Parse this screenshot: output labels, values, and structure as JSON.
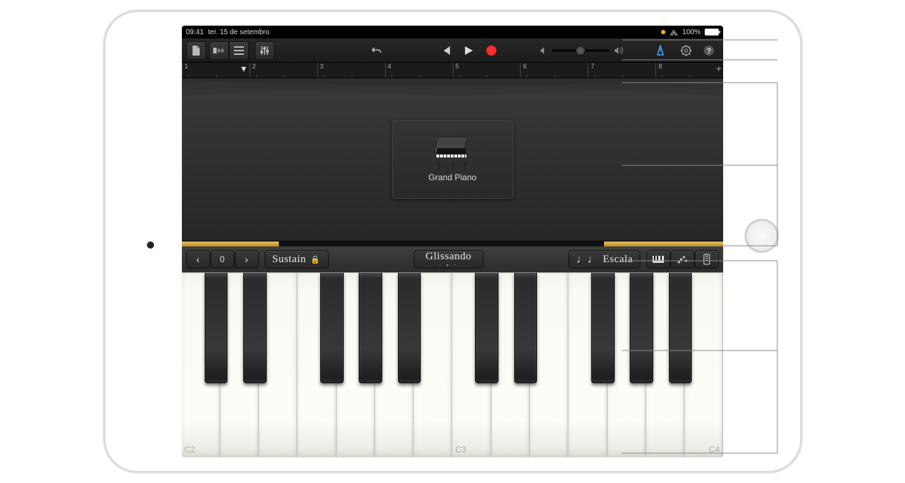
{
  "statusbar": {
    "time": "09:41",
    "date": "ter. 15 de setembro",
    "battery_pct": "100%"
  },
  "ruler": {
    "marks": [
      "1",
      "2",
      "3",
      "4",
      "5",
      "6",
      "7",
      "8"
    ]
  },
  "instrument": {
    "name": "Grand Piano"
  },
  "controls": {
    "octave_value": "0",
    "sustain": "Sustain",
    "glissando": "Glissando",
    "scale": "Escala"
  },
  "keys": {
    "labels": {
      "c2": "C2",
      "c3": "C3",
      "c4": "C4"
    }
  },
  "blackkeys": [
    4.2,
    11.35,
    25.6,
    32.75,
    39.9,
    54.2,
    61.35,
    75.6,
    82.75,
    89.9
  ]
}
